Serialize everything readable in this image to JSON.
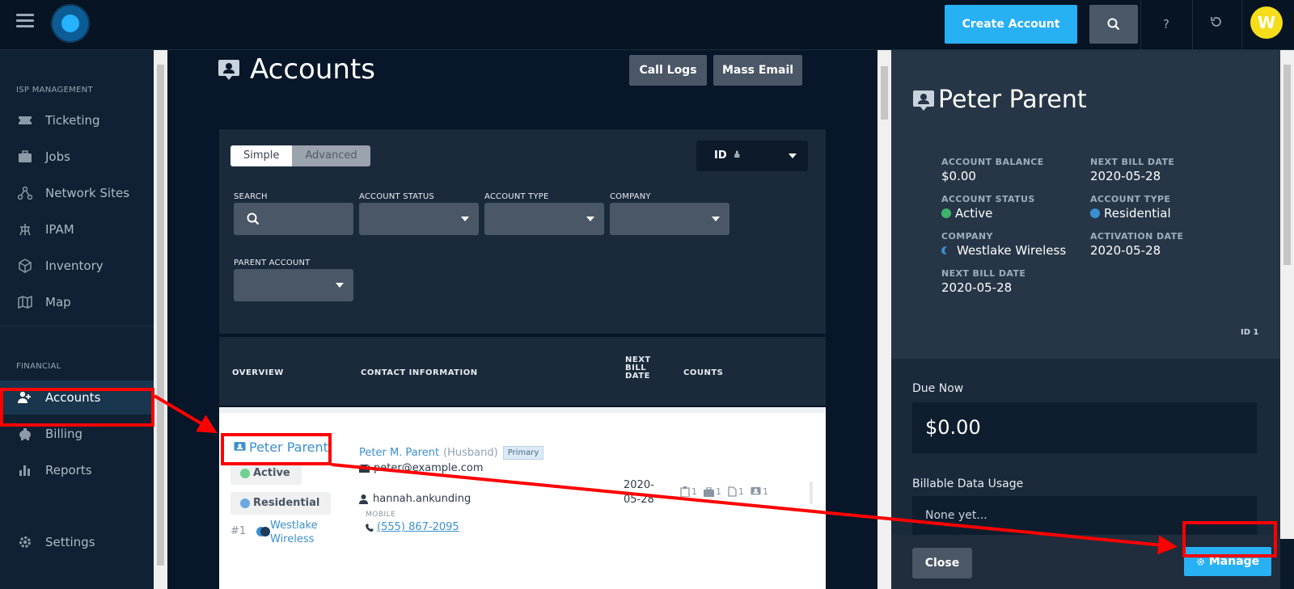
{
  "topbar": {
    "create_account": "Create Account",
    "avatar_initial": "W",
    "help": "?"
  },
  "sidebar": {
    "section_isp": "ISP MANAGEMENT",
    "section_financial": "FINANCIAL",
    "items": [
      {
        "label": "Ticketing",
        "icon": "ticket-icon"
      },
      {
        "label": "Jobs",
        "icon": "briefcase-icon"
      },
      {
        "label": "Network Sites",
        "icon": "network-icon"
      },
      {
        "label": "IPAM",
        "icon": "ipam-icon"
      },
      {
        "label": "Inventory",
        "icon": "box-icon"
      },
      {
        "label": "Map",
        "icon": "map-icon"
      },
      {
        "label": "Accounts",
        "icon": "accounts-icon"
      },
      {
        "label": "Billing",
        "icon": "billing-icon"
      },
      {
        "label": "Reports",
        "icon": "reports-icon"
      },
      {
        "label": "Settings",
        "icon": "gear-icon"
      }
    ]
  },
  "main": {
    "title": "Accounts",
    "call_logs": "Call Logs",
    "mass_email": "Mass Email",
    "toggle_simple": "Simple",
    "toggle_advanced": "Advanced",
    "sort_label": "ID",
    "filters": {
      "search": "SEARCH",
      "account_status": "ACCOUNT STATUS",
      "account_type": "ACCOUNT TYPE",
      "company": "COMPANY",
      "parent_account": "PARENT ACCOUNT"
    },
    "columns": {
      "overview": "OVERVIEW",
      "contact": "CONTACT INFORMATION",
      "next_bill_1": "NEXT",
      "next_bill_2": "BILL",
      "next_bill_3": "DATE",
      "counts": "COUNTS"
    },
    "row": {
      "name": "Peter Parent",
      "status": "Active",
      "type": "Residential",
      "number": "#1",
      "company_line1": "Westlake",
      "company_line2": "Wireless",
      "contact_name": "Peter M. Parent",
      "contact_relation": "(Husband)",
      "contact_badge": "Primary",
      "email": "peter@example.com",
      "username": "hannah.ankunding",
      "phone_label": "MOBILE",
      "phone": "(555) 867-2095",
      "bill_date_1": "2020-",
      "bill_date_2": "05-28",
      "counts": [
        "1",
        "1",
        "1",
        "1"
      ]
    }
  },
  "detail": {
    "name": "Peter Parent",
    "fields": [
      {
        "label": "ACCOUNT BALANCE",
        "value": "$0.00"
      },
      {
        "label": "NEXT BILL DATE",
        "value": "2020-05-28"
      },
      {
        "label": "ACCOUNT STATUS",
        "value": "Active"
      },
      {
        "label": "ACCOUNT TYPE",
        "value": "Residential"
      },
      {
        "label": "COMPANY",
        "value": "Westlake Wireless"
      },
      {
        "label": "ACTIVATION DATE",
        "value": "2020-05-28"
      },
      {
        "label": "NEXT BILL DATE",
        "value": "2020-05-28"
      }
    ],
    "id_tag": "ID 1",
    "due_now_label": "Due Now",
    "due_now_value": "$0.00",
    "usage_label": "Billable Data Usage",
    "usage_value": "None yet...",
    "close": "Close",
    "manage": "Manage"
  },
  "colors": {
    "accent": "#28b0f5",
    "active": "#3fb46f",
    "residential": "#6aa8e0",
    "annotation": "#ff0000"
  }
}
